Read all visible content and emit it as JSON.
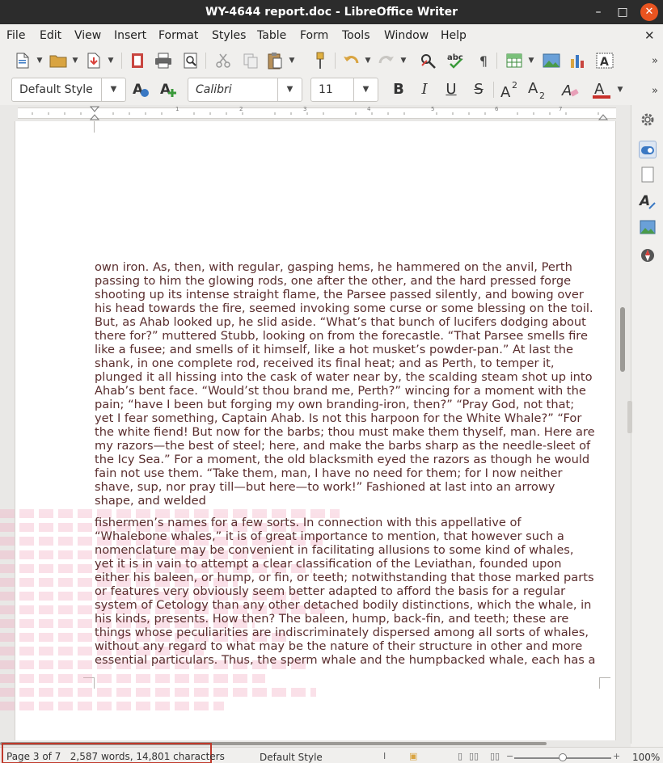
{
  "window": {
    "title": "WY-4644 report.doc - LibreOffice Writer",
    "minimize_glyph": "–",
    "maximize_glyph": "□",
    "close_glyph": "✕"
  },
  "menu": {
    "items": [
      "File",
      "Edit",
      "View",
      "Insert",
      "Format",
      "Styles",
      "Table",
      "Form",
      "Tools",
      "Window",
      "Help"
    ],
    "close_doc_glyph": "✕"
  },
  "toolbar2": {
    "paragraph_style": "Default Style",
    "font_name": "Calibri",
    "font_size": "11",
    "bold": "B",
    "italic": "I",
    "underline": "U",
    "strike": "S"
  },
  "ruler": {
    "numbers": [
      "1",
      "2",
      "3",
      "4",
      "5",
      "6",
      "7"
    ]
  },
  "document": {
    "paragraph1": [
      "own iron. As, then, with regular, gasping hems, he hammered on the anvil, Perth",
      "passing to him the glowing rods, one after the other, and the hard pressed forge",
      "shooting up its intense straight flame, the Parsee passed silently, and bowing over",
      "his head towards the fire, seemed invoking some curse or some blessing on the toil.",
      "But, as Ahab looked up, he slid aside. “What’s that bunch of lucifers dodging about",
      "there for?” muttered Stubb, looking on from the forecastle. “That Parsee smells fire",
      "like a fusee; and smells of it himself, like a hot musket’s powder-pan.” At last the",
      "shank, in one complete rod, received its final heat; and as Perth, to temper it,",
      "plunged it all hissing into the cask of water near by, the scalding steam shot up into",
      "Ahab’s bent face. “Would’st thou brand me, Perth?” wincing for a moment with the",
      "pain; “have I been but forging my own branding-iron, then?” “Pray God, not that;",
      "yet I fear something, Captain Ahab. Is not this harpoon for the White Whale?” “For",
      "the white fiend! But now for the barbs; thou must make them thyself, man. Here are",
      "my razors—the best of steel; here, and make the barbs sharp as the needle-sleet of",
      "the Icy Sea.” For a moment, the old blacksmith eyed the razors as though he would",
      "fain not use them. “Take them, man, I have no need for them; for I now neither",
      "shave, sup, nor pray till—but here—to work!” Fashioned at last into an arrowy",
      "shape, and welded"
    ],
    "paragraph2": [
      "fishermen’s names for a few sorts. In connection with this appellative of",
      "“Whalebone whales,” it is of great importance to mention, that however such a",
      "nomenclature may be convenient in facilitating allusions to some kind of whales,",
      "yet it is in vain to attempt a clear classification of the Leviathan, founded upon",
      "either his baleen, or hump, or fin, or teeth; notwithstanding that those marked parts",
      "or features very obviously seem better adapted to afford the basis for a regular",
      "system of Cetology than any other detached bodily distinctions, which the whale, in",
      "his kinds, presents. How then? The baleen, hump, back-fin, and teeth; these are",
      "things whose peculiarities are indiscriminately dispersed among all sorts of whales,",
      "without any regard to what may be the nature of their structure in other and more",
      "essential particulars. Thus, the sperm whale and the humpbacked whale, each has a"
    ]
  },
  "statusbar": {
    "page_info": "Page 3 of 7",
    "word_info": "2,587 words, 14,801 characters",
    "style": "Default Style",
    "zoom": "100%",
    "zoom_fraction": 0.5
  },
  "colors": {
    "titlebar": "#2c2c2c",
    "close_button": "#e95420",
    "text": "#5a2e2e",
    "highlight_box": "#c0392b"
  }
}
